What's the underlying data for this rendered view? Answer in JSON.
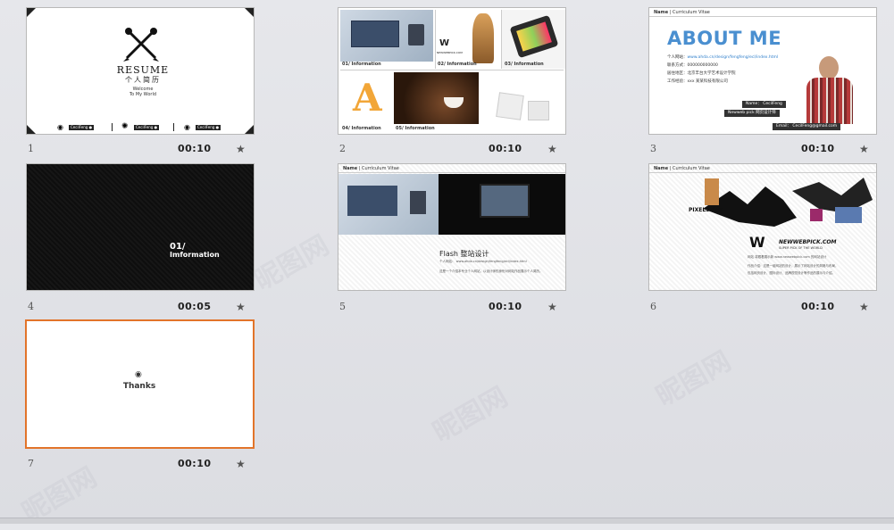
{
  "slides": [
    {
      "number": "1",
      "time": "00:10"
    },
    {
      "number": "2",
      "time": "00:10"
    },
    {
      "number": "3",
      "time": "00:10"
    },
    {
      "number": "4",
      "time": "00:05"
    },
    {
      "number": "5",
      "time": "00:10"
    },
    {
      "number": "6",
      "time": "00:10"
    },
    {
      "number": "7",
      "time": "00:10"
    }
  ],
  "star_icon": "★",
  "slide1": {
    "title": "RESUME",
    "subtitle": "个人简历",
    "small1": "Welcome",
    "small2": "To My World",
    "tag": "CecilFeng ●"
  },
  "slide2": {
    "caps": [
      "01/ Information",
      "02/ Information",
      "03/ Information",
      "04/ Information",
      "05/ Information"
    ],
    "brand": "NEWWEBPICK.COM"
  },
  "slide3": {
    "hdr_bold": "Name",
    "hdr_rest": "| Curriculum Vitae",
    "about": "ABOUT ME",
    "info": [
      {
        "label": "个人网站：",
        "value": "www.ahda.cn/design/fengfeng/ecl/index.html"
      },
      {
        "label": "联系方式：",
        "value": "000000000000"
      },
      {
        "label": "居住地区：",
        "value": "北京丰台大学艺术设计学院"
      },
      {
        "label": "工作经验：",
        "value": "xxx 某某科技有限公司"
      }
    ],
    "name": "Name： CecilFeng",
    "role": "Newweb pick 网页设计师",
    "email": "Email： CecilFeng@gmail.com"
  },
  "slide4": {
    "num": "01/",
    "label": "Imformation"
  },
  "slide5": {
    "hdr_bold": "Name",
    "hdr_rest": "| Curriculum Vitae",
    "title": "Flash 整站设计",
    "line1": "个人网站：  www.ahda.cn/design/fengfeng/ecl/index.html",
    "line2": "这是一个介绍本专业个人网站，以设计师的身份对网站作品展示个人简历。"
  },
  "slide6": {
    "hdr_bold": "Name",
    "hdr_rest": "| Curriculum Vitae",
    "logo1": "PIXELS CAT",
    "logo2": "NEWWEBPICK.COM",
    "tagline": "SUPER PICK OF THE WORLD",
    "line1": "网站 将跟着展示新 www.newwebpick.com 的网站设计",
    "line2": "作品介绍：这是一组网站的设计，展示了网站设计的风格与布局，",
    "line3": "包括网页设计、图标设计、品牌视觉设计等作品的展示与介绍。"
  },
  "slide7": {
    "thanks": "Thanks"
  },
  "watermark": "昵图网"
}
